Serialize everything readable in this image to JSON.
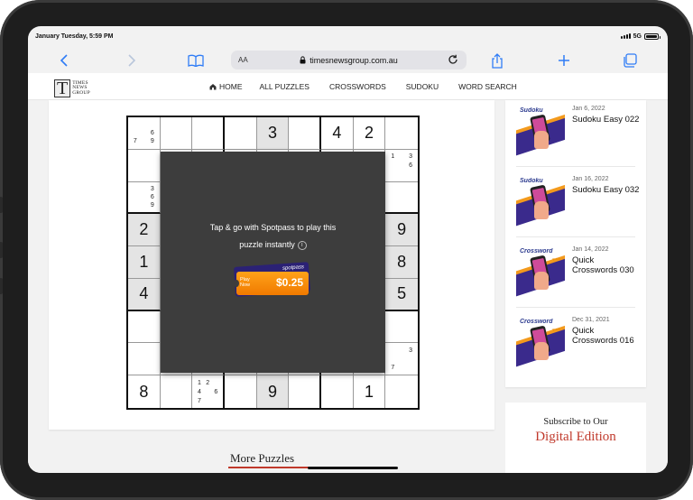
{
  "status_bar": {
    "time": "January Tuesday, 5:59 PM",
    "network": "5G"
  },
  "browser": {
    "text_size_label": "AA",
    "url": "timesnewsgroup.com.au"
  },
  "site": {
    "logo_line1": "TIMES",
    "logo_line2": "NEWS",
    "logo_line3": "GROUP",
    "nav": [
      "HOME",
      "ALL PUZZLES",
      "CROSSWORDS",
      "SUDOKU",
      "WORD SEARCH"
    ]
  },
  "sudoku": {
    "cells": [
      [
        "n:6,7,9",
        "",
        "",
        "",
        "3",
        "",
        "4",
        "2",
        ""
      ],
      [
        "",
        "",
        "",
        "",
        "",
        "",
        "",
        "",
        "n:1,3,6"
      ],
      [
        "n:3,6,9",
        "",
        "",
        "",
        "",
        "",
        "",
        "",
        ""
      ],
      [
        "2",
        "",
        "",
        "",
        "",
        "",
        "",
        "",
        "9"
      ],
      [
        "1",
        "",
        "",
        "",
        "",
        "",
        "",
        "",
        "8"
      ],
      [
        "4",
        "",
        "",
        "",
        "",
        "",
        "",
        "",
        "5"
      ],
      [
        "",
        "",
        "",
        "",
        "",
        "",
        "",
        "",
        ""
      ],
      [
        "",
        "",
        "",
        "",
        "",
        "",
        "",
        "",
        "n:3,7"
      ],
      [
        "8",
        "",
        "n:1,2,4,6,7",
        "",
        "9",
        "",
        "",
        "1",
        ""
      ]
    ]
  },
  "overlay": {
    "line1": "Tap & go with Spotpass to play this",
    "line2": "puzzle instantly",
    "info_glyph": "i",
    "ticket_brand": "spotpass",
    "ticket_play1": "Play",
    "ticket_play2": "Now",
    "ticket_price": "$0.25"
  },
  "sidebar": {
    "items": [
      {
        "label": "Sudoku",
        "date": "Jan 6, 2022",
        "title": "Sudoku Easy 022"
      },
      {
        "label": "Sudoku",
        "date": "Jan 16, 2022",
        "title": "Sudoku Easy 032"
      },
      {
        "label": "Crossword",
        "sub": "quick",
        "date": "Jan 14, 2022",
        "title": "Quick Crosswords 030"
      },
      {
        "label": "Crossword",
        "sub": "quick",
        "date": "Dec 31, 2021",
        "title": "Quick Crosswords 016"
      }
    ]
  },
  "subscribe": {
    "line1": "Subscribe to Our",
    "line2": "Digital Edition"
  },
  "more_puzzles": "More Puzzles",
  "colors": {
    "accent": "#2f7cf6",
    "brand_red": "#c0392b",
    "ticket_orange": "#f07a00",
    "ticket_navy": "#2b2175"
  },
  "icons": {
    "back": "chevron-left-icon",
    "forward": "chevron-right-icon",
    "bookmarks": "book-icon",
    "lock": "lock-icon",
    "reload": "reload-icon",
    "share": "share-icon",
    "new_tab": "plus-icon",
    "tabs": "tabs-icon",
    "home": "home-icon"
  }
}
